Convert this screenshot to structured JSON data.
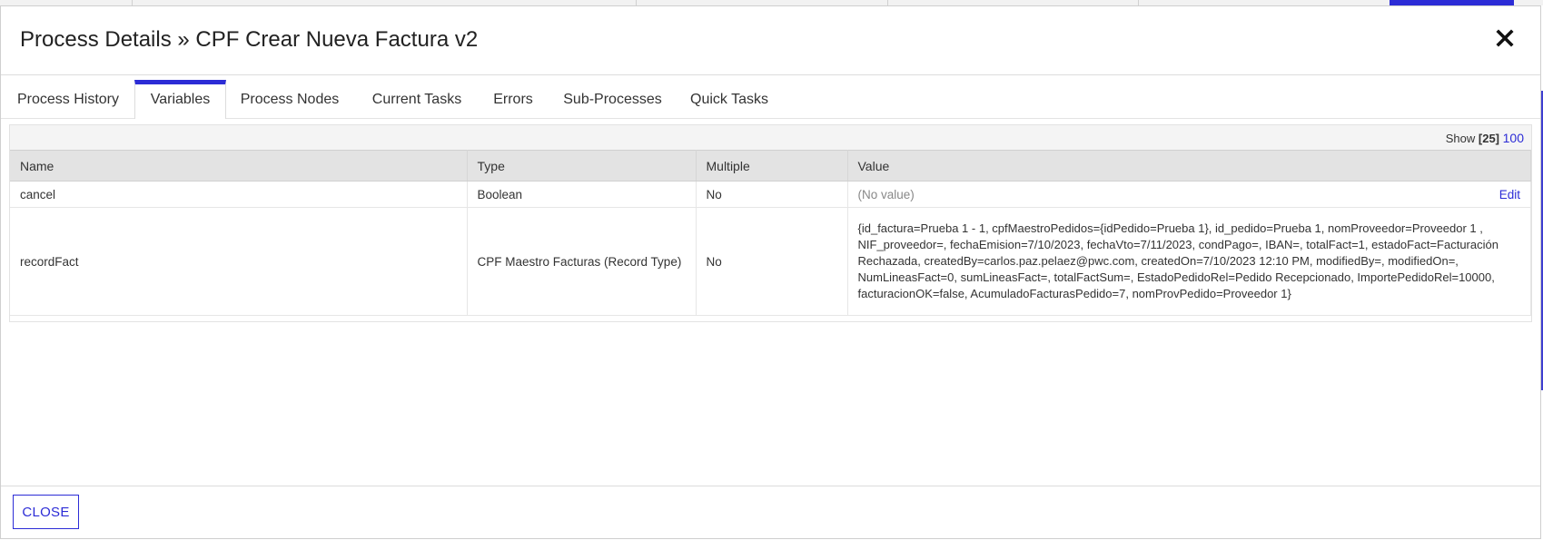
{
  "modal": {
    "title": "Process Details » CPF Crear Nueva Factura v2",
    "close_icon": "close-icon"
  },
  "tabs": [
    {
      "label": "Process History",
      "active": false
    },
    {
      "label": "Variables",
      "active": true
    },
    {
      "label": "Process Nodes",
      "active": false
    },
    {
      "label": "Current Tasks",
      "active": false
    },
    {
      "label": "Errors",
      "active": false
    },
    {
      "label": "Sub-Processes",
      "active": false
    },
    {
      "label": "Quick Tasks",
      "active": false
    }
  ],
  "grid": {
    "show_label": "Show",
    "page_size_selected": "[25]",
    "page_size_other": "100",
    "columns": [
      "Name",
      "Type",
      "Multiple",
      "Value"
    ],
    "rows": [
      {
        "name": "cancel",
        "type": "Boolean",
        "multiple": "No",
        "value": "(No value)",
        "action": "Edit"
      },
      {
        "name": "recordFact",
        "type": "CPF Maestro Facturas (Record Type)",
        "multiple": "No",
        "value": "{id_factura=Prueba 1 - 1, cpfMaestroPedidos={idPedido=Prueba 1}, id_pedido=Prueba 1, nomProveedor=Proveedor 1 , NIF_proveedor=, fechaEmision=7/10/2023, fechaVto=7/11/2023, condPago=, IBAN=, totalFact=1, estadoFact=Facturación Rechazada, createdBy=carlos.paz.pelaez@pwc.com, createdOn=7/10/2023 12:10 PM, modifiedBy=, modifiedOn=, NumLineasFact=0, sumLineasFact=, totalFactSum=, EstadoPedidoRel=Pedido Recepcionado, ImportePedidoRel=10000, facturacionOK=false, AcumuladoFacturasPedido=7, nomProvPedido=Proveedor 1}"
      }
    ]
  },
  "footer": {
    "close_label": "CLOSE"
  },
  "colors": {
    "accent": "#2c2cd6",
    "header_bg": "#e3e3e3"
  }
}
